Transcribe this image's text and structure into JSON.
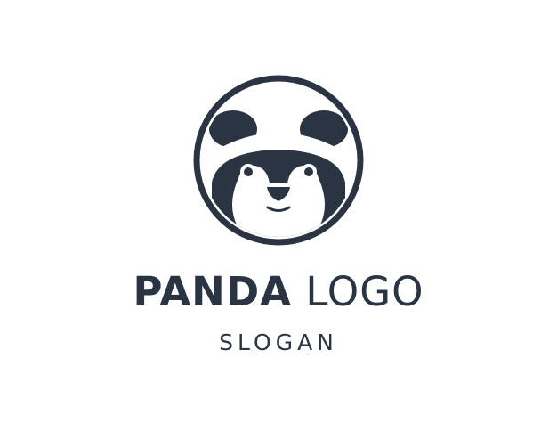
{
  "logo": {
    "icon": "panda-face-icon",
    "primary_color": "#2a3442",
    "background_color": "#ffffff",
    "title_bold": "PANDA",
    "title_light": "LOGO",
    "slogan": "SLOGAN"
  }
}
